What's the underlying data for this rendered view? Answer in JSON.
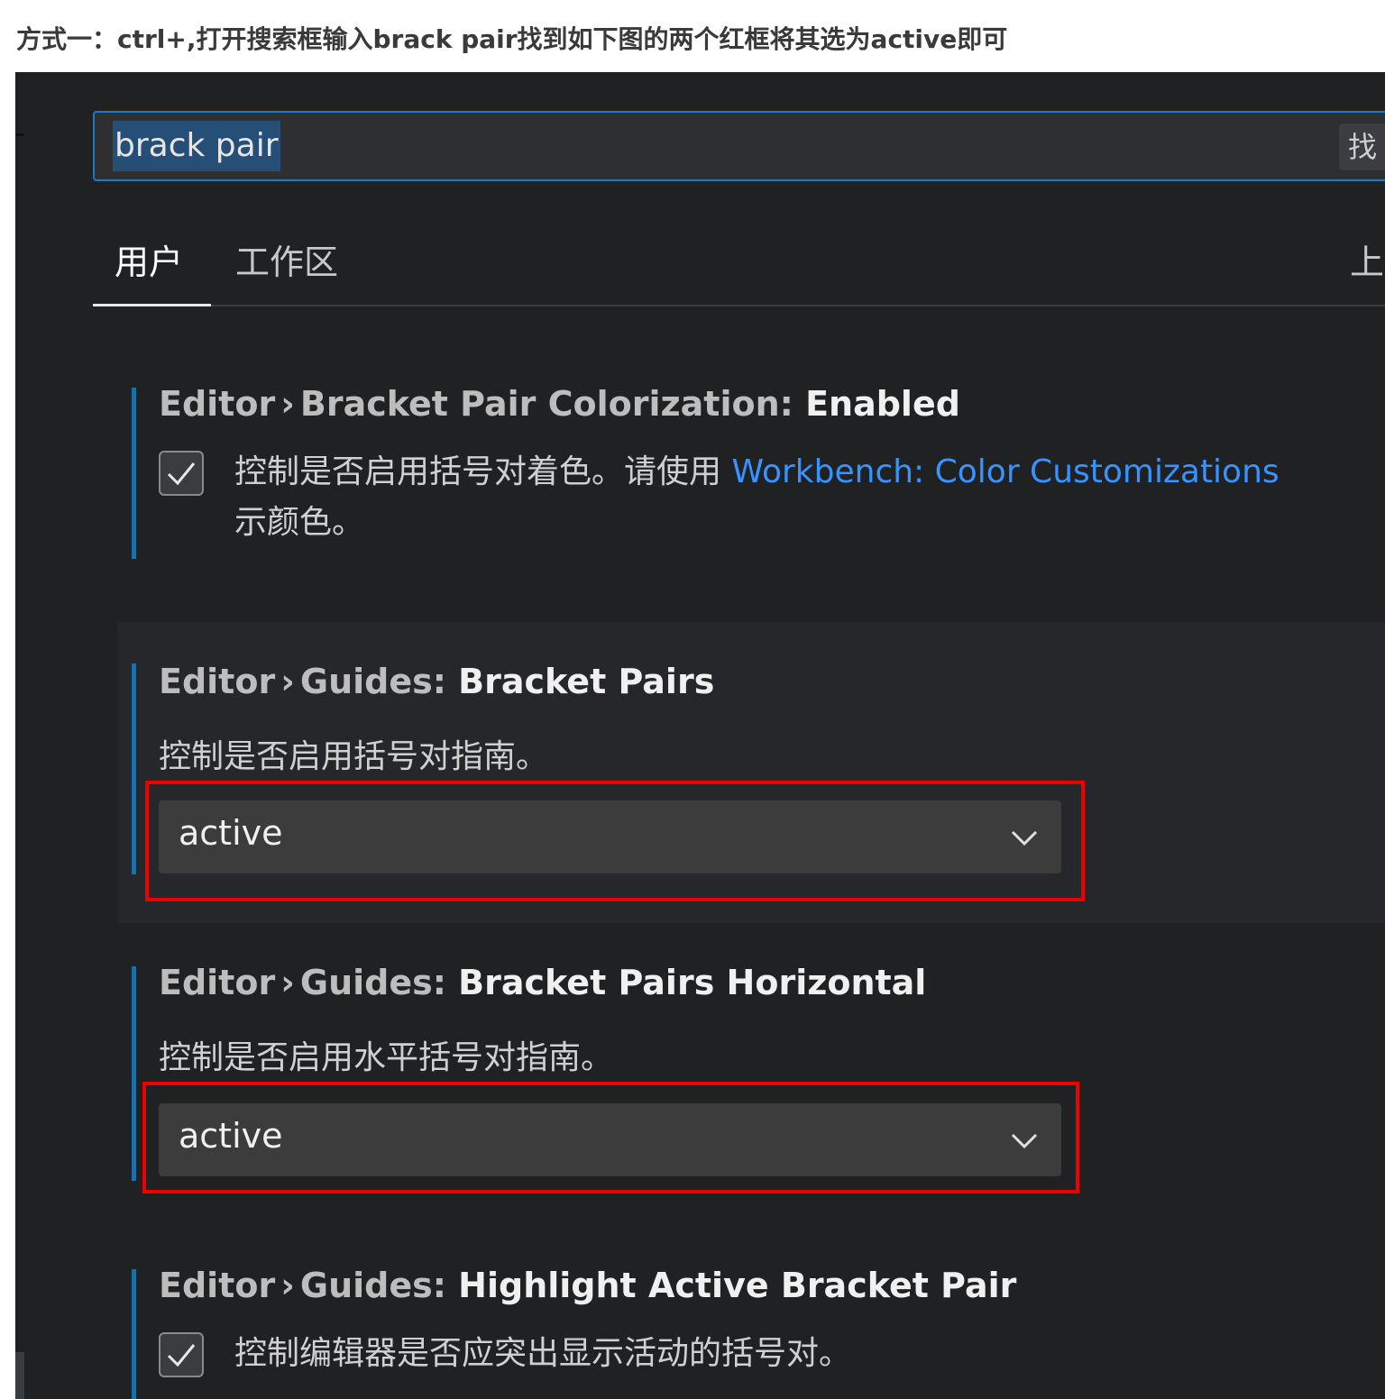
{
  "caption": "方式一：ctrl+,打开搜索框输入brack pair找到如下图的两个红框将其选为active即可",
  "search": {
    "value": "brack pair",
    "filter_label": "找"
  },
  "tabs": {
    "user": "用户",
    "workspace": "工作区",
    "right_label": "上次"
  },
  "settings": [
    {
      "category": "Editor",
      "separator": "›",
      "group": "Bracket Pair Colorization:",
      "name": "Enabled",
      "control": "checkbox",
      "checked": true,
      "description_before": "控制是否启用括号对着色。请使用",
      "description_link": "Workbench: Color Customizations",
      "description_after": "示颜色。"
    },
    {
      "category": "Editor",
      "separator": "›",
      "group": "Guides:",
      "name": "Bracket Pairs",
      "control": "select",
      "description": "控制是否启用括号对指南。",
      "selected": "active"
    },
    {
      "category": "Editor",
      "separator": "›",
      "group": "Guides:",
      "name": "Bracket Pairs Horizontal",
      "control": "select",
      "description": "控制是否启用水平括号对指南。",
      "selected": "active"
    },
    {
      "category": "Editor",
      "separator": "›",
      "group": "Guides:",
      "name": "Highlight Active Bracket Pair",
      "control": "checkbox",
      "checked": true,
      "description": "控制编辑器是否应突出显示活动的括号对。"
    }
  ],
  "colors": {
    "background": "#1f2123",
    "accent": "#1f7ac4",
    "link": "#3794ff",
    "highlight_box": "#ee0000"
  },
  "icons": {
    "checkbox": "check-icon",
    "select": "chevron-down-icon"
  }
}
